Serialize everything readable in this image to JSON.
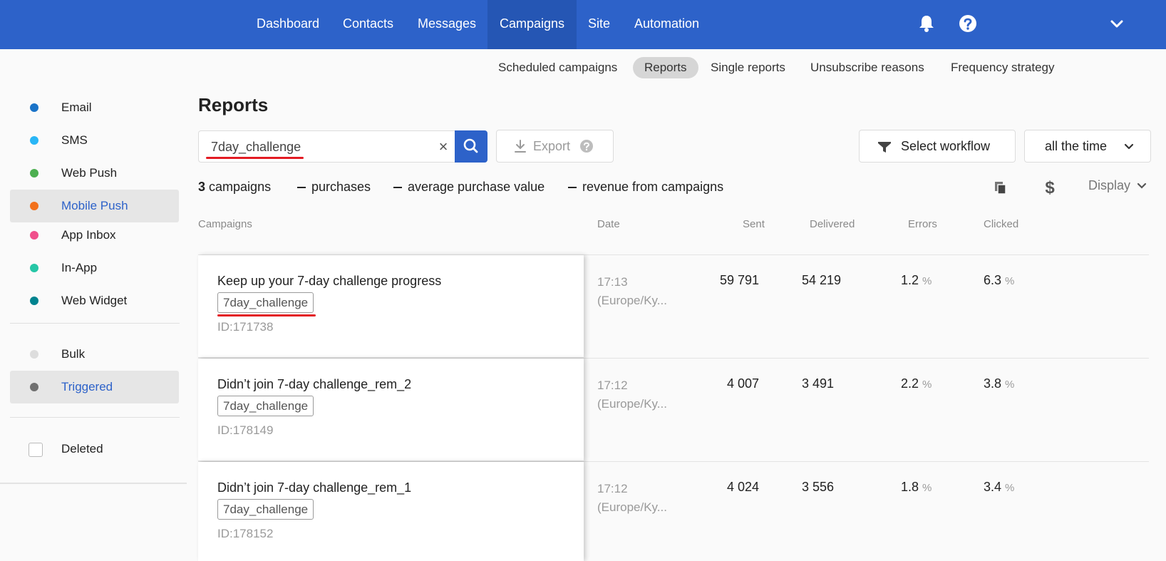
{
  "colors": {
    "accent": "#2d62c9",
    "highlight_underline": "#e31b23"
  },
  "topnav": {
    "items": [
      {
        "label": "Dashboard"
      },
      {
        "label": "Contacts"
      },
      {
        "label": "Messages"
      },
      {
        "label": "Campaigns",
        "active": true
      },
      {
        "label": "Site"
      },
      {
        "label": "Automation"
      }
    ],
    "icons": [
      "bell-icon",
      "help-icon",
      "chevron-down-icon"
    ]
  },
  "subnav": {
    "items": [
      {
        "label": "Scheduled campaigns"
      },
      {
        "label": "Reports",
        "active": true
      },
      {
        "label": "Single reports"
      },
      {
        "label": "Unsubscribe reasons"
      },
      {
        "label": "Frequency strategy"
      }
    ]
  },
  "sidebar": {
    "channels": [
      {
        "label": "Email",
        "color": "#1a73c8"
      },
      {
        "label": "SMS",
        "color": "#29b6f6"
      },
      {
        "label": "Web Push",
        "color": "#4caf50"
      },
      {
        "label": "Mobile Push",
        "color": "#f2711c",
        "selected": true
      },
      {
        "label": "App Inbox",
        "color": "#f0508c"
      },
      {
        "label": "In-App",
        "color": "#26c6a6"
      },
      {
        "label": "Web Widget",
        "color": "#00838f"
      }
    ],
    "types": [
      {
        "label": "Bulk",
        "color": "#dddddd"
      },
      {
        "label": "Triggered",
        "color": "#707070",
        "selected": true
      }
    ],
    "deleted_label": "Deleted"
  },
  "main": {
    "title": "Reports",
    "search": {
      "value": "7day_challenge",
      "placeholder": ""
    },
    "export_label": "Export",
    "workflow_label": "Select workflow",
    "period_label": "all the time",
    "display_label": "Display",
    "summary": {
      "count": "3",
      "count_label": "campaigns",
      "purchases_label": "purchases",
      "avg_label": "average purchase value",
      "revenue_label": "revenue from campaigns"
    },
    "table": {
      "headers": {
        "campaigns": "Campaigns",
        "date": "Date",
        "sent": "Sent",
        "delivered": "Delivered",
        "errors": "Errors",
        "clicked": "Clicked"
      },
      "rows": [
        {
          "name": "Keep up your 7-day challenge progress",
          "tag": "7day_challenge",
          "id": "ID:171738",
          "time": "17:13",
          "tz": "(Europe/Ky...",
          "sent": "59 791",
          "delivered": "54 219",
          "errors": "1.2",
          "clicked": "6.3"
        },
        {
          "name": "Didn’t join 7-day challenge_rem_2",
          "tag": "7day_challenge",
          "id": "ID:178149",
          "time": "17:12",
          "tz": "(Europe/Ky...",
          "sent": "4 007",
          "delivered": "3 491",
          "errors": "2.2",
          "clicked": "3.8"
        },
        {
          "name": "Didn’t join 7-day challenge_rem_1",
          "tag": "7day_challenge",
          "id": "ID:178152",
          "time": "17:12",
          "tz": "(Europe/Ky...",
          "sent": "4 024",
          "delivered": "3 556",
          "errors": "1.8",
          "clicked": "3.4"
        }
      ],
      "percent_sign": "%"
    }
  }
}
